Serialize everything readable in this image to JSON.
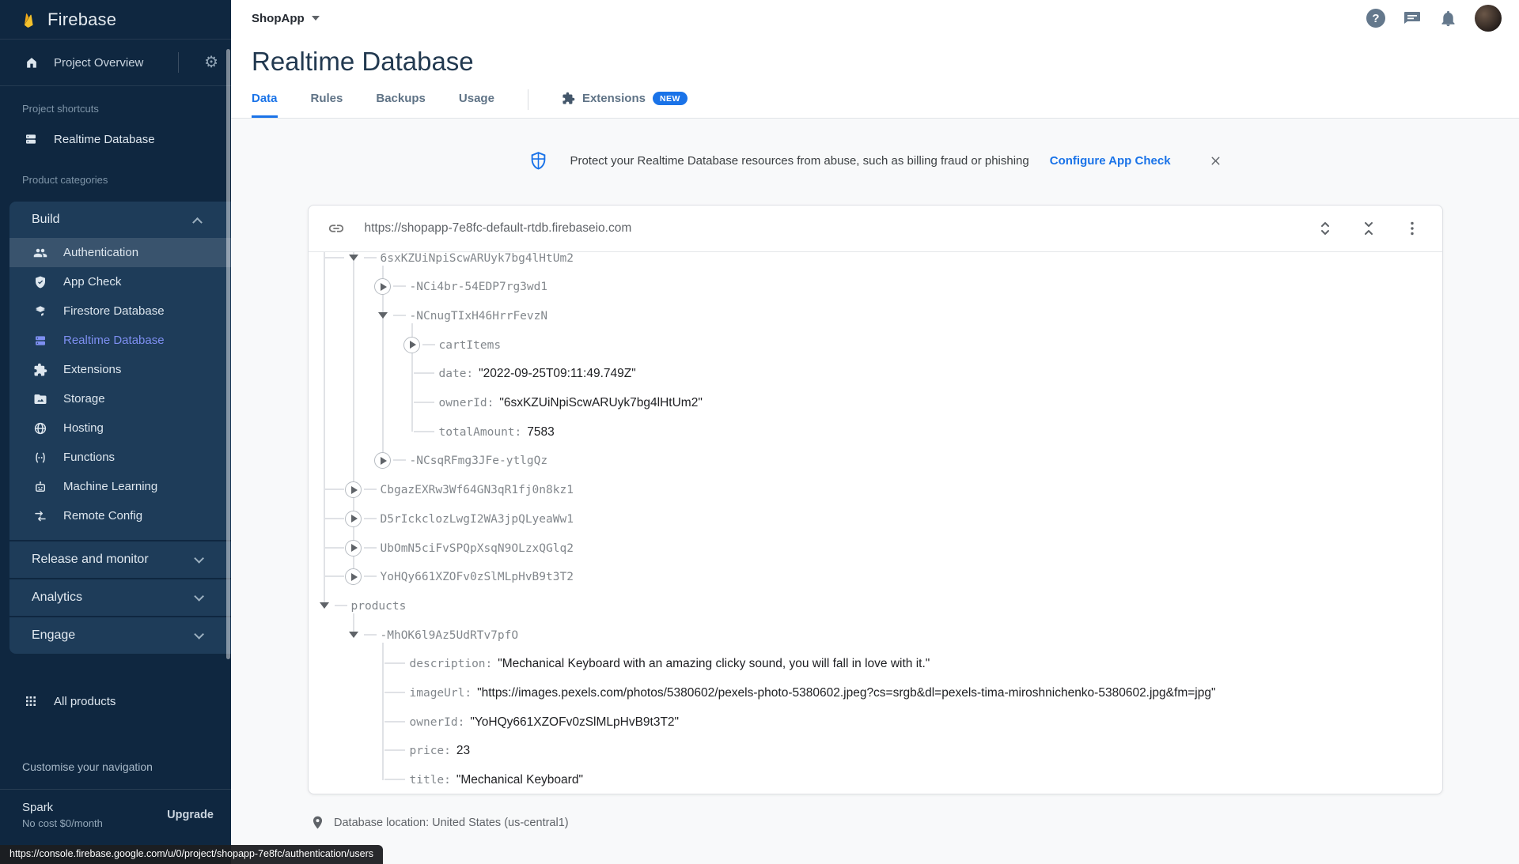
{
  "colors": {
    "accent": "#1a73e8",
    "selected_item": "#7e8ff1",
    "sidebar_bg": "#0f2740",
    "sidebar_card_bg": "#1e3c59",
    "badge_bg": "#1a73e8",
    "flame_main": "#f3c12c",
    "flame_dark": "#f0a818"
  },
  "sidebar": {
    "logo": "Firebase",
    "project_overview": "Project Overview",
    "shortcuts_label": "Project shortcuts",
    "shortcut": {
      "label": "Realtime Database",
      "icon": "database-icon"
    },
    "categories_label": "Product categories",
    "sections": [
      {
        "label": "Build",
        "expanded": true,
        "items": [
          {
            "label": "Authentication",
            "icon": "people-icon",
            "highlighted": true
          },
          {
            "label": "App Check",
            "icon": "shield-check-icon"
          },
          {
            "label": "Firestore Database",
            "icon": "firestore-icon"
          },
          {
            "label": "Realtime Database",
            "icon": "database-icon",
            "selected": true
          },
          {
            "label": "Extensions",
            "icon": "puzzle-icon"
          },
          {
            "label": "Storage",
            "icon": "folder-icon"
          },
          {
            "label": "Hosting",
            "icon": "globe-icon"
          },
          {
            "label": "Functions",
            "icon": "functions-icon"
          },
          {
            "label": "Machine Learning",
            "icon": "robot-icon"
          },
          {
            "label": "Remote Config",
            "icon": "swap-arrows-icon"
          }
        ]
      },
      {
        "label": "Release and monitor",
        "expanded": false
      },
      {
        "label": "Analytics",
        "expanded": false
      },
      {
        "label": "Engage",
        "expanded": false
      }
    ],
    "all_products": "All products",
    "customise": "Customise your navigation",
    "plan": {
      "name": "Spark",
      "cost": "No cost $0/month",
      "upgrade": "Upgrade"
    }
  },
  "topbar": {
    "project": "ShopApp",
    "icons": [
      "help-icon",
      "feedback-icon",
      "bell-icon",
      "avatar"
    ]
  },
  "page": {
    "title": "Realtime Database",
    "tabs": [
      {
        "label": "Data",
        "active": true
      },
      {
        "label": "Rules"
      },
      {
        "label": "Backups"
      },
      {
        "label": "Usage"
      },
      {
        "label": "Extensions",
        "icon": "puzzle-icon",
        "badge": "NEW",
        "divider_before": true
      }
    ]
  },
  "banner": {
    "icon": "app-check-shield-icon",
    "text": "Protect your Realtime Database resources from abuse, such as billing fraud or phishing",
    "link": "Configure App Check",
    "close_icon": "close-icon"
  },
  "db_panel": {
    "url": "https://shopapp-7e8fc-default-rtdb.firebaseio.com",
    "url_icon": "link-icon",
    "action_icons": [
      "expand-all-icon",
      "collapse-all-icon",
      "kebab-menu-icon"
    ],
    "tree": {
      "rows": [
        {
          "d": 1,
          "t": "e",
          "label": "6sxKZUiNpiScwARUyk7bg4lHtUm2"
        },
        {
          "d": 2,
          "t": "c",
          "label": "-NCi4br-54EDP7rg3wd1"
        },
        {
          "d": 2,
          "t": "e",
          "label": "-NCnugTIxH46HrrFevzN"
        },
        {
          "d": 3,
          "t": "c",
          "label": "cartItems"
        },
        {
          "d": 3,
          "t": "l",
          "key": "date",
          "value": "\"2022-09-25T09:11:49.749Z\""
        },
        {
          "d": 3,
          "t": "l",
          "key": "ownerId",
          "value": "\"6sxKZUiNpiScwARUyk7bg4lHtUm2\""
        },
        {
          "d": 3,
          "t": "l",
          "key": "totalAmount",
          "value": "7583"
        },
        {
          "d": 2,
          "t": "c",
          "label": "-NCsqRFmg3JFe-ytlgQz"
        },
        {
          "d": 1,
          "t": "c",
          "label": "CbgazEXRw3Wf64GN3qR1fj0n8kz1"
        },
        {
          "d": 1,
          "t": "c",
          "label": "D5rIckclozLwgI2WA3jpQLyeaWw1"
        },
        {
          "d": 1,
          "t": "c",
          "label": "UbOmN5ciFvSPQpXsqN9OLzxQGlq2"
        },
        {
          "d": 1,
          "t": "c",
          "label": "YoHQy661XZOFv0zSlMLpHvB9t3T2"
        },
        {
          "d": 0,
          "t": "e",
          "label": "products"
        },
        {
          "d": 1,
          "t": "e",
          "label": "-MhOK6l9Az5UdRTv7pfO"
        },
        {
          "d": 2,
          "t": "l",
          "key": "description",
          "value": "\"Mechanical Keyboard with an amazing clicky sound, you will fall in love with it.\""
        },
        {
          "d": 2,
          "t": "l",
          "key": "imageUrl",
          "value": "\"https://images.pexels.com/photos/5380602/pexels-photo-5380602.jpeg?cs=srgb&dl=pexels-tima-miroshnichenko-5380602.jpg&fm=jpg\""
        },
        {
          "d": 2,
          "t": "l",
          "key": "ownerId",
          "value": "\"YoHQy661XZOFv0zSlMLpHvB9t3T2\""
        },
        {
          "d": 2,
          "t": "l",
          "key": "price",
          "value": "23"
        },
        {
          "d": 2,
          "t": "l",
          "key": "title",
          "value": "\"Mechanical Keyboard\""
        }
      ]
    }
  },
  "footer": {
    "icon": "location-pin-icon",
    "location": "Database location: United States (us-central1)"
  },
  "statusbar": {
    "url": "https://console.firebase.google.com/u/0/project/shopapp-7e8fc/authentication/users"
  }
}
